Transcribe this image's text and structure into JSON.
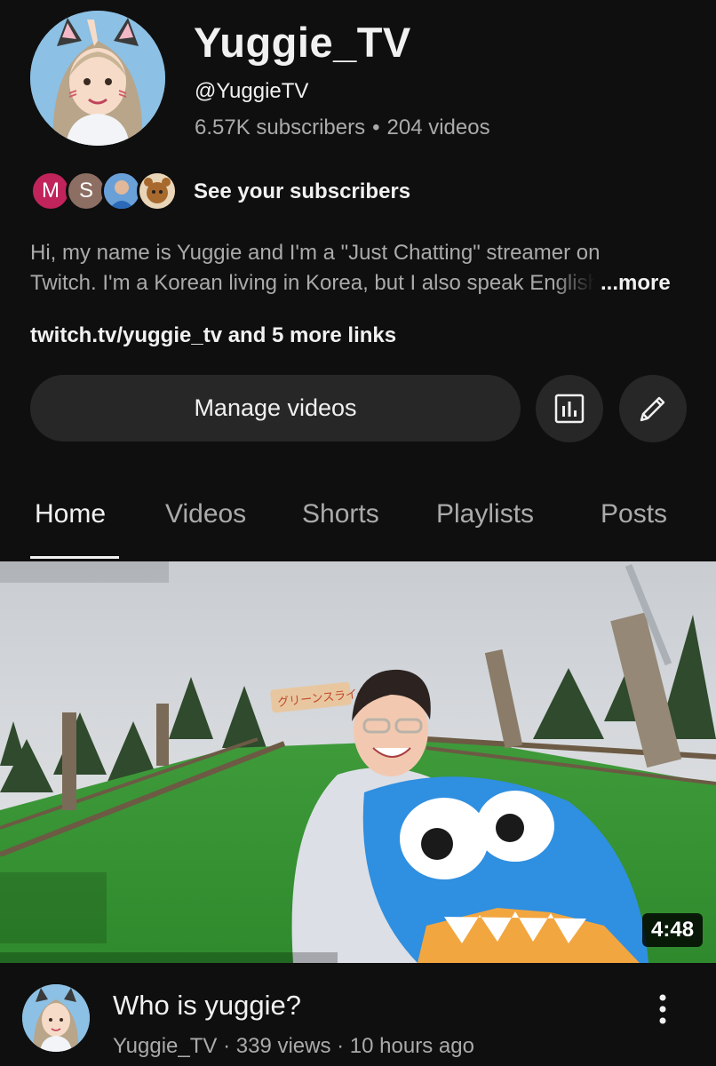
{
  "channel": {
    "name": "Yuggie_TV",
    "handle": "@YuggieTV",
    "subscribers": "6.57K subscribers",
    "separator": "•",
    "videos": "204 videos"
  },
  "subscribers_preview": {
    "avatars": [
      {
        "initial": "M",
        "color": "#c0245a"
      },
      {
        "initial": "S",
        "color": "#8d6e63"
      },
      {
        "initial": "",
        "color": "#3f6fb8"
      },
      {
        "initial": "",
        "color": "#8a5a2b"
      }
    ],
    "label": "See your subscribers"
  },
  "description": {
    "line1": "Hi, my name is Yuggie and I'm a \"Just Chatting\" streamer on",
    "line2": "Twitch. I'm a Korean living in Korea, but I also speak English",
    "more": "...more"
  },
  "links": {
    "text": "twitch.tv/yuggie_tv and 5 more links"
  },
  "actions": {
    "manage_videos": "Manage videos"
  },
  "tabs": [
    {
      "label": "Home",
      "active": true
    },
    {
      "label": "Videos",
      "active": false
    },
    {
      "label": "Shorts",
      "active": false
    },
    {
      "label": "Playlists",
      "active": false
    },
    {
      "label": "Posts",
      "active": false
    }
  ],
  "featured_video": {
    "duration": "4:48",
    "title": "Who is yuggie?",
    "meta": "Yuggie_TV · 339 views · 10 hours ago",
    "sign_text": "グリーンスライダー"
  }
}
